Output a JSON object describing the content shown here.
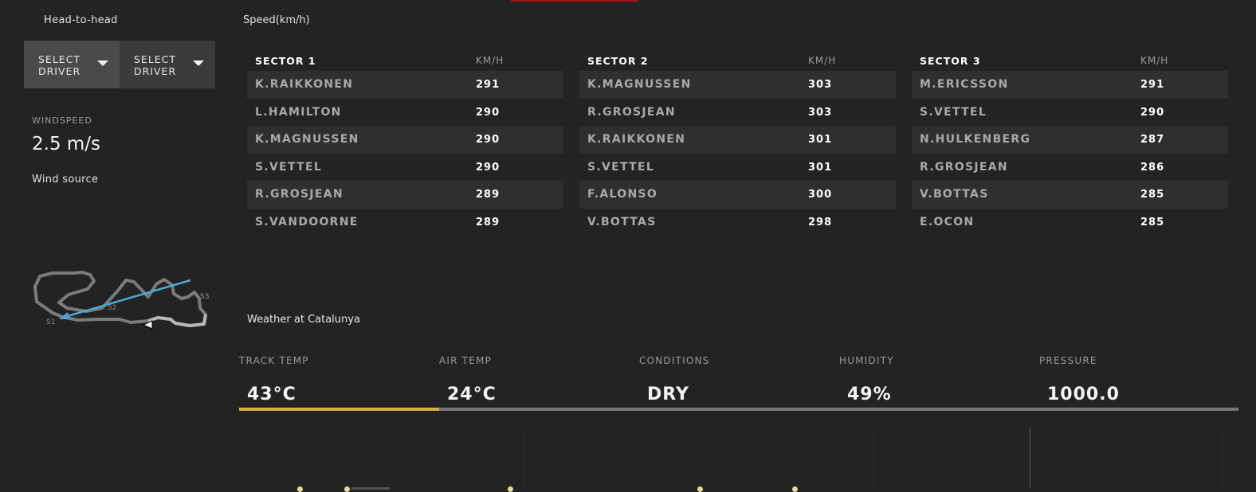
{
  "left_panel": {
    "h2h_label": "Head-to-head",
    "driver_select_1": "SELECT DRIVER",
    "driver_select_2": "SELECT DRIVER",
    "windspeed_label": "WINDSPEED",
    "windspeed_value": "2.5 m/s",
    "wind_source_label": "Wind source",
    "track_sector_labels": [
      "S1",
      "S2",
      "S3"
    ]
  },
  "speed": {
    "title": "Speed(km/h)",
    "unit_header": "KM/H",
    "sectors": [
      {
        "title": "SECTOR 1",
        "rows": [
          {
            "driver": "K.RAIKKONEN",
            "speed": "291"
          },
          {
            "driver": "L.HAMILTON",
            "speed": "290"
          },
          {
            "driver": "K.MAGNUSSEN",
            "speed": "290"
          },
          {
            "driver": "S.VETTEL",
            "speed": "290"
          },
          {
            "driver": "R.GROSJEAN",
            "speed": "289"
          },
          {
            "driver": "S.VANDOORNE",
            "speed": "289"
          }
        ]
      },
      {
        "title": "SECTOR 2",
        "rows": [
          {
            "driver": "K.MAGNUSSEN",
            "speed": "303"
          },
          {
            "driver": "R.GROSJEAN",
            "speed": "303"
          },
          {
            "driver": "K.RAIKKONEN",
            "speed": "301"
          },
          {
            "driver": "S.VETTEL",
            "speed": "301"
          },
          {
            "driver": "F.ALONSO",
            "speed": "300"
          },
          {
            "driver": "V.BOTTAS",
            "speed": "298"
          }
        ]
      },
      {
        "title": "SECTOR 3",
        "rows": [
          {
            "driver": "M.ERICSSON",
            "speed": "291"
          },
          {
            "driver": "S.VETTEL",
            "speed": "290"
          },
          {
            "driver": "N.HULKENBERG",
            "speed": "287"
          },
          {
            "driver": "R.GROSJEAN",
            "speed": "286"
          },
          {
            "driver": "V.BOTTAS",
            "speed": "285"
          },
          {
            "driver": "E.OCON",
            "speed": "285"
          }
        ]
      }
    ]
  },
  "weather": {
    "title": "Weather at Catalunya",
    "items": [
      {
        "label": "TRACK TEMP",
        "value": "43°C"
      },
      {
        "label": "AIR TEMP",
        "value": "24°C"
      },
      {
        "label": "CONDITIONS",
        "value": "DRY"
      },
      {
        "label": "HUMIDITY",
        "value": "49%"
      },
      {
        "label": "PRESSURE",
        "value": "1000.0"
      }
    ]
  },
  "colors": {
    "background": "#232323",
    "accent_red": "#a31515",
    "track_temp_bar": "#d4b24a",
    "wind_arrow": "#4aa8d8"
  }
}
